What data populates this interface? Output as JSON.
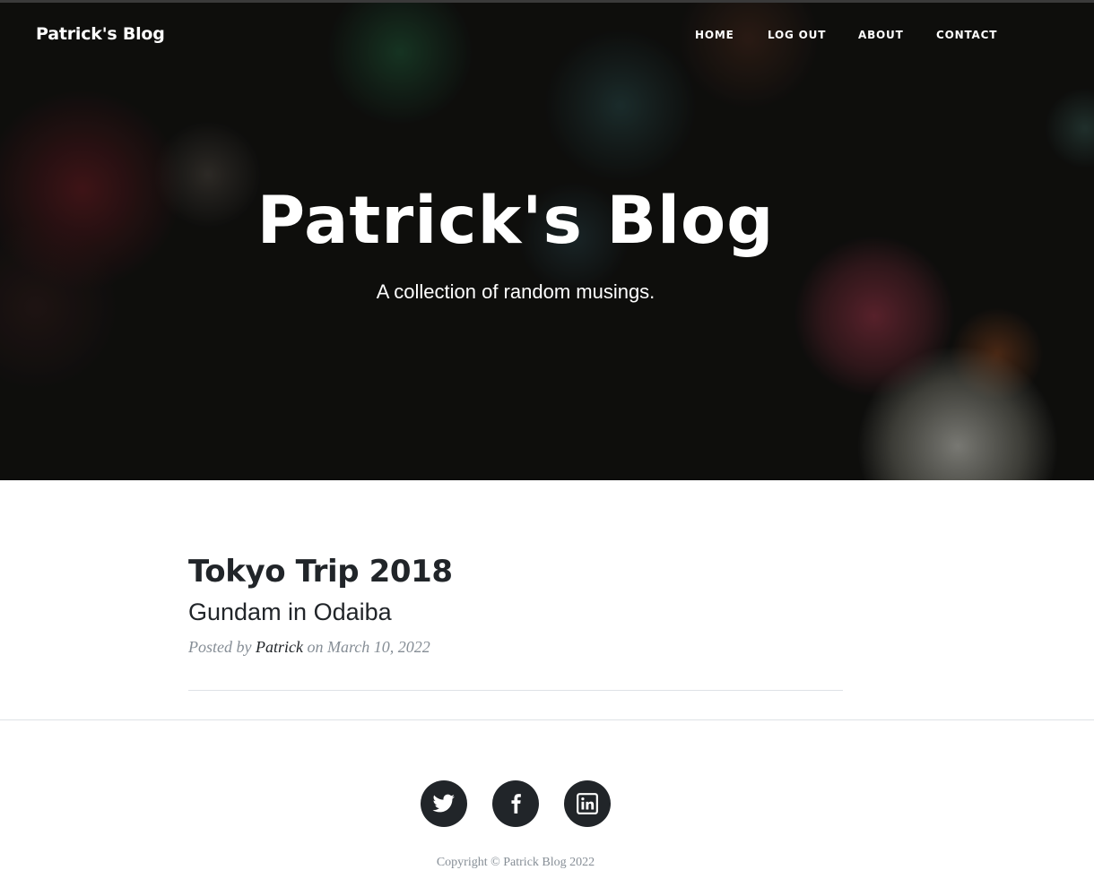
{
  "nav": {
    "brand": "Patrick's Blog",
    "items": [
      {
        "label": "HOME"
      },
      {
        "label": "LOG OUT"
      },
      {
        "label": "ABOUT"
      },
      {
        "label": "CONTACT"
      }
    ]
  },
  "masthead": {
    "title": "Patrick's Blog",
    "subtitle": "A collection of random musings."
  },
  "post": {
    "title": "Tokyo Trip 2018",
    "subtitle": "Gundam in Odaiba",
    "meta_prefix": "Posted by",
    "author": "Patrick",
    "meta_on": "on",
    "date": "March 10, 2022"
  },
  "footer": {
    "social": [
      {
        "icon": "twitter-icon"
      },
      {
        "icon": "facebook-icon"
      },
      {
        "icon": "linkedin-icon"
      }
    ],
    "copyright": "Copyright © Patrick Blog 2022"
  },
  "colors": {
    "text": "#212529",
    "muted": "#868e96",
    "divider": "#dee2e6",
    "nav_text": "#ffffff"
  }
}
